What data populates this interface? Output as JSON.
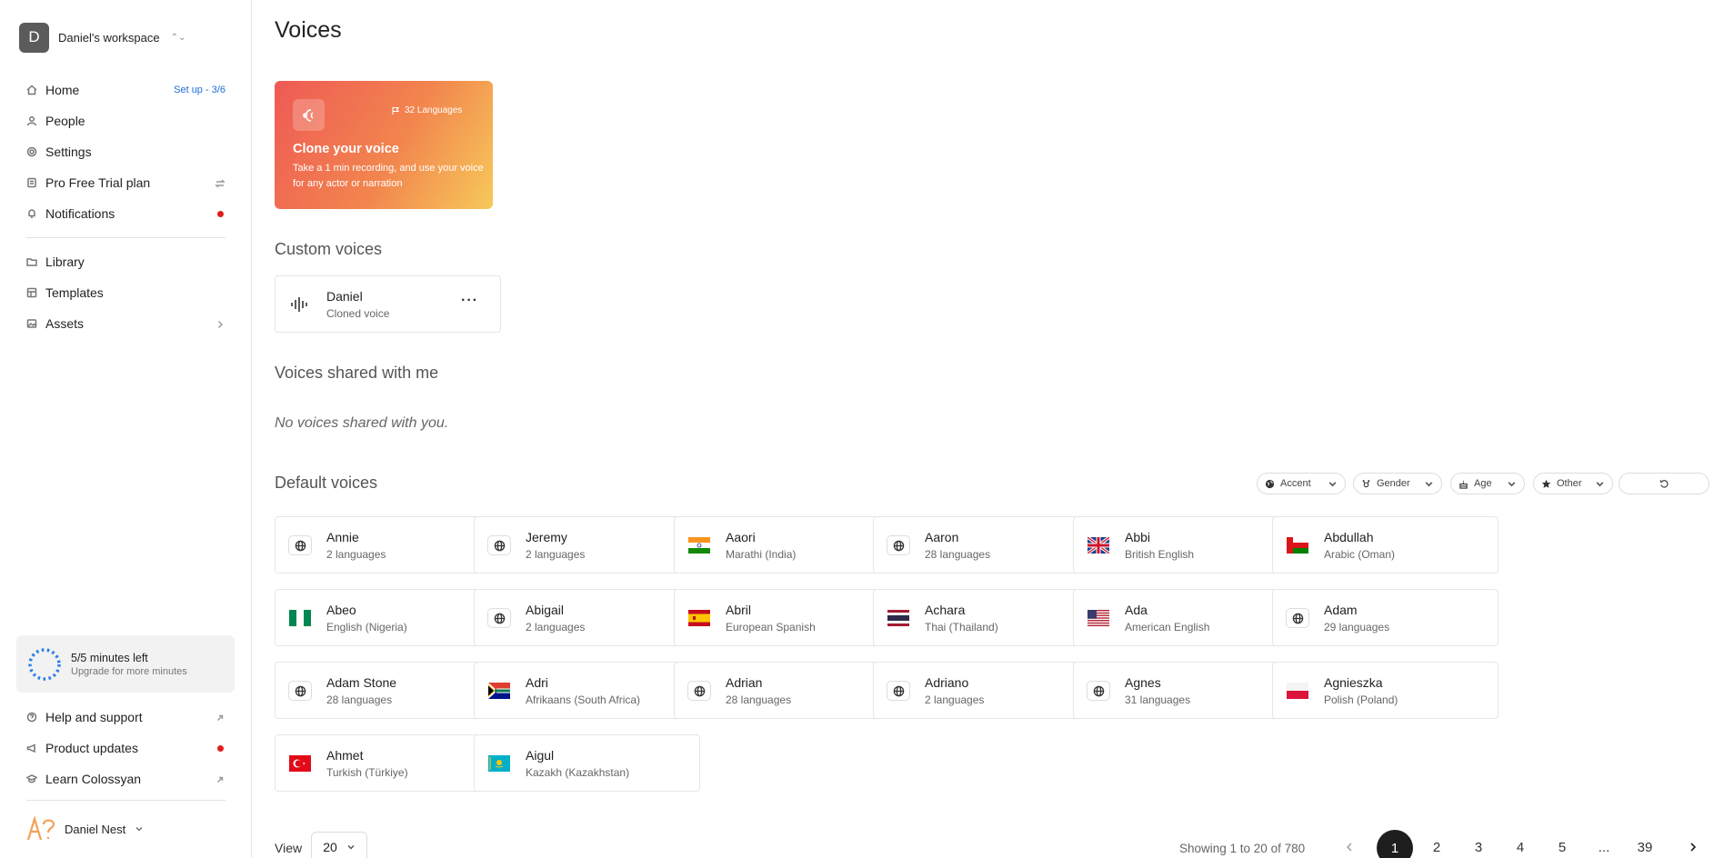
{
  "workspace": {
    "initial": "D",
    "name": "Daniel's workspace"
  },
  "nav": {
    "home": "Home",
    "setup": "Set up - 3/6",
    "people": "People",
    "settings": "Settings",
    "plan": "Pro Free Trial plan",
    "notifications": "Notifications",
    "library": "Library",
    "templates": "Templates",
    "assets": "Assets"
  },
  "minutes": {
    "title": "5/5 minutes left",
    "sub": "Upgrade for more minutes"
  },
  "footer_nav": {
    "help": "Help and support",
    "updates": "Product updates",
    "learn": "Learn Colossyan"
  },
  "user": {
    "name": "Daniel Nest"
  },
  "page": {
    "title": "Voices"
  },
  "clone": {
    "languages": "32 Languages",
    "title": "Clone your voice",
    "desc": "Take a 1 min recording, and use your voice for any actor or narration"
  },
  "sections": {
    "custom": "Custom voices",
    "shared": "Voices shared with me",
    "shared_empty": "No voices shared with you.",
    "default": "Default voices"
  },
  "custom_voices": [
    {
      "name": "Daniel",
      "sub": "Cloned voice"
    }
  ],
  "filters": {
    "accent": "Accent",
    "gender": "Gender",
    "age": "Age",
    "other": "Other"
  },
  "default_voices": [
    {
      "name": "Annie",
      "sub": "2 languages",
      "icon": "globe"
    },
    {
      "name": "Jeremy",
      "sub": "2 languages",
      "icon": "globe"
    },
    {
      "name": "Aaori",
      "sub": "Marathi (India)",
      "icon": "flag-in"
    },
    {
      "name": "Aaron",
      "sub": "28 languages",
      "icon": "globe"
    },
    {
      "name": "Abbi",
      "sub": "British English",
      "icon": "flag-gb"
    },
    {
      "name": "Abdullah",
      "sub": "Arabic (Oman)",
      "icon": "flag-om"
    },
    {
      "name": "Abeo",
      "sub": "English (Nigeria)",
      "icon": "flag-ng"
    },
    {
      "name": "Abigail",
      "sub": "2 languages",
      "icon": "globe"
    },
    {
      "name": "Abril",
      "sub": "European Spanish",
      "icon": "flag-es"
    },
    {
      "name": "Achara",
      "sub": "Thai (Thailand)",
      "icon": "flag-th"
    },
    {
      "name": "Ada",
      "sub": "American English",
      "icon": "flag-us"
    },
    {
      "name": "Adam",
      "sub": "29 languages",
      "icon": "globe"
    },
    {
      "name": "Adam Stone",
      "sub": "28 languages",
      "icon": "globe"
    },
    {
      "name": "Adri",
      "sub": "Afrikaans (South Africa)",
      "icon": "flag-za"
    },
    {
      "name": "Adrian",
      "sub": "28 languages",
      "icon": "globe"
    },
    {
      "name": "Adriano",
      "sub": "2 languages",
      "icon": "globe"
    },
    {
      "name": "Agnes",
      "sub": "31 languages",
      "icon": "globe"
    },
    {
      "name": "Agnieszka",
      "sub": "Polish (Poland)",
      "icon": "flag-pl"
    },
    {
      "name": "Ahmet",
      "sub": "Turkish (Türkiye)",
      "icon": "flag-tr"
    },
    {
      "name": "Aigul",
      "sub": "Kazakh (Kazakhstan)",
      "icon": "flag-kz"
    }
  ],
  "pagination": {
    "view_label": "View",
    "page_size": "20",
    "showing": "Showing 1 to 20 of 780",
    "pages": [
      "1",
      "2",
      "3",
      "4",
      "5",
      "...",
      "39"
    ]
  }
}
